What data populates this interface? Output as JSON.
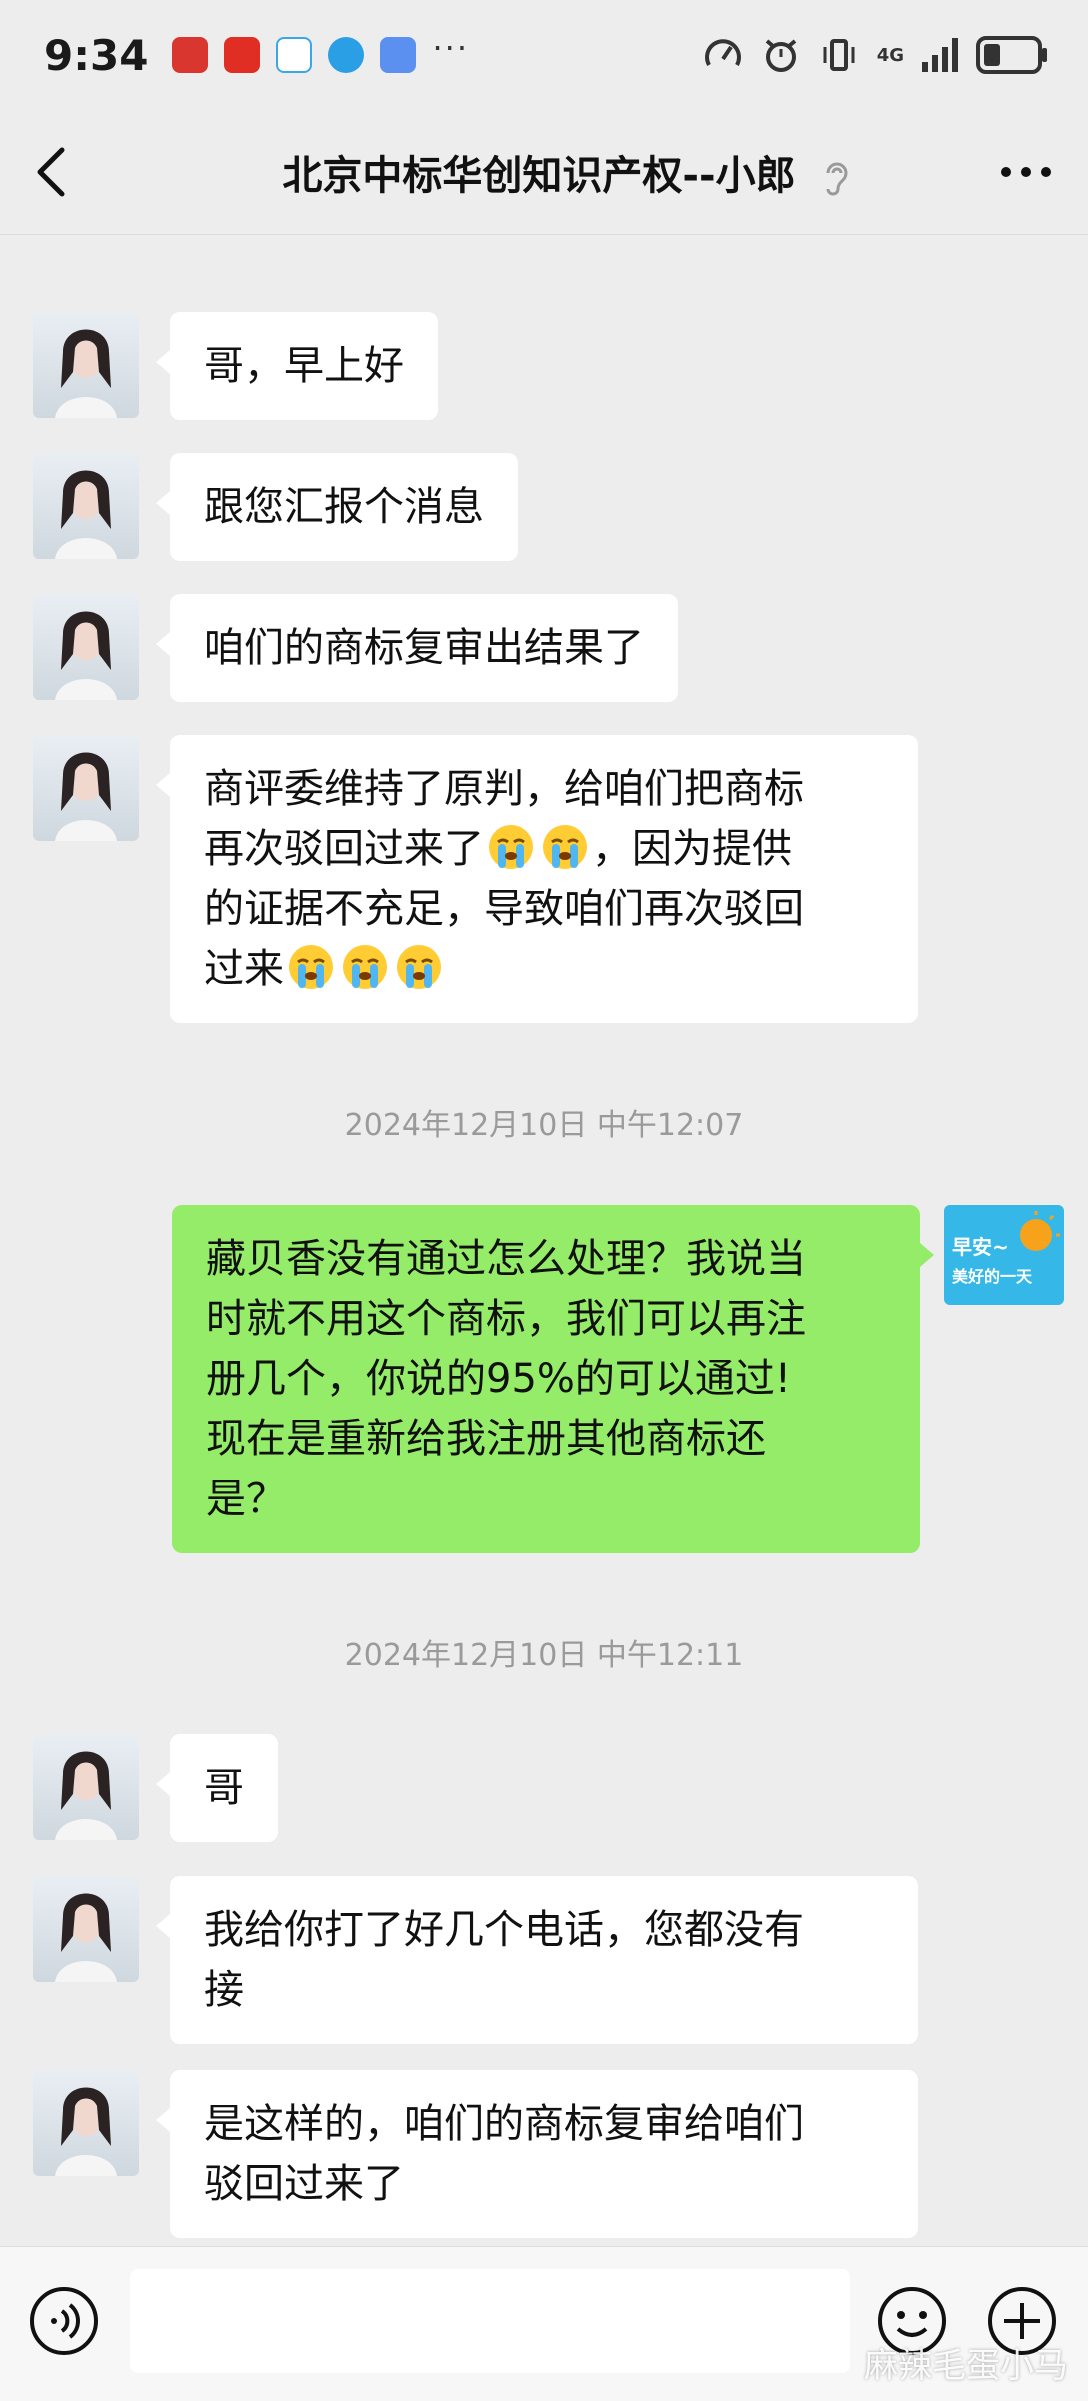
{
  "status_bar": {
    "time": "9:34",
    "network": "4G",
    "app_icons": [
      "app-icon-red",
      "app-icon-pinduoduo",
      "app-icon-search",
      "app-icon-browser",
      "app-icon-music"
    ]
  },
  "header": {
    "title": "北京中标华创知识产权--小郎"
  },
  "messages": [
    {
      "id": "m1",
      "text": "哥，早上好"
    },
    {
      "id": "m2",
      "text": "跟您汇报个消息"
    },
    {
      "id": "m3",
      "text": "咱们的商标复审出结果了"
    },
    {
      "id": "m4",
      "lines": [
        "商评委维持了原判，给咱们把商标",
        "再次驳回过来了",
        "，因为提供",
        "的证据不充足，导致咱们再次驳回",
        "过来"
      ]
    },
    {
      "id": "ts1",
      "timestamp": "2024年12月10日 中午12:07"
    },
    {
      "id": "m5",
      "lines": [
        "藏贝香没有通过怎么处理？我说当",
        "时就不用这个商标，我们可以再注",
        "册几个，你说的95%的可以通过!",
        "现在是重新给我注册其他商标还",
        "是？"
      ]
    },
    {
      "id": "ts2",
      "timestamp": "2024年12月10日 中午12:11"
    },
    {
      "id": "m6",
      "text": "哥"
    },
    {
      "id": "m7",
      "lines": [
        "我给你打了好几个电话，您都没有",
        "接"
      ]
    },
    {
      "id": "m8",
      "lines": [
        "是这样的，咱们的商标复审给咱们",
        "驳回过来了"
      ]
    }
  ],
  "self_avatar": {
    "line1": "早安~",
    "line2": "美好的一天"
  },
  "input": {
    "placeholder": ""
  },
  "watermark": "麻辣毛蛋小马",
  "colors": {
    "background": "#ededed",
    "incoming_bubble": "#ffffff",
    "outgoing_bubble": "#95ec69",
    "timestamp": "#9a9a9a"
  },
  "icons": {
    "back": "chevron-left-icon",
    "ear": "ear-icon",
    "more": "more-dots-icon",
    "voice": "voice-icon",
    "emoji": "emoji-icon",
    "plus": "plus-icon",
    "crying_emoji": "crying-face-emoji"
  }
}
